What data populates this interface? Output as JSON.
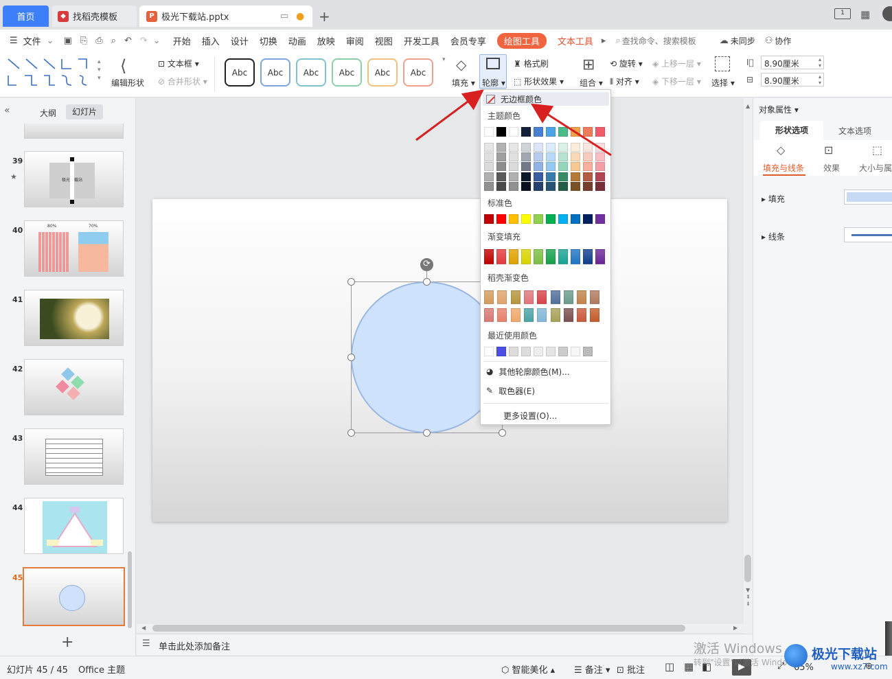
{
  "tabs": {
    "home": "首页",
    "template": "找稻壳模板",
    "document": "极光下载站.pptx"
  },
  "menu": {
    "file": "文件",
    "items": [
      "开始",
      "插入",
      "设计",
      "切换",
      "动画",
      "放映",
      "审阅",
      "视图",
      "开发工具",
      "会员专享"
    ],
    "drawing_tools": "绘图工具",
    "text_tools": "文本工具",
    "search_placeholder": "查找命令、搜索模板",
    "sync": "未同步",
    "collab": "协作"
  },
  "ribbon": {
    "textbox": "文本框",
    "edit_shape": "编辑形状",
    "merge_shape": "合并形状",
    "style_label": "Abc",
    "fill": "填充",
    "outline": "轮廓",
    "format_painter": "格式刷",
    "shape_effects": "形状效果",
    "group": "组合",
    "rotate": "旋转",
    "align": "对齐",
    "bring_forward": "上移一层",
    "send_backward": "下移一层",
    "select": "选择",
    "height": "8.90厘米",
    "width": "8.90厘米"
  },
  "left_panel": {
    "outline_tab": "大纲",
    "slides_tab": "幻灯片",
    "slide_numbers": [
      "39",
      "40",
      "41",
      "42",
      "43",
      "44",
      "45"
    ],
    "thumb39_text": "极光下载站",
    "thumb40_labels": [
      "80%",
      "70%"
    ]
  },
  "notes": {
    "placeholder": "单击此处添加备注"
  },
  "status": {
    "slide_info": "幻灯片 45 / 45",
    "theme": "Office 主题",
    "smart_beautify": "智能美化",
    "notes": "备注",
    "comments": "批注",
    "zoom": "65%"
  },
  "right_panel": {
    "title": "对象属性",
    "tab_shape": "形状选项",
    "tab_text": "文本选项",
    "sub_fill_line": "填充与线条",
    "sub_effects": "效果",
    "sub_size": "大小与属",
    "fill": "填充",
    "line": "线条"
  },
  "dropdown": {
    "no_border": "无边框颜色",
    "theme_colors": "主题颜色",
    "standard_colors": "标准色",
    "gradient_fill": "渐变填充",
    "docer_gradient": "稻壳渐变色",
    "recent_colors": "最近使用颜色",
    "more_colors": "其他轮廓颜色(M)...",
    "eyedropper": "取色器(E)",
    "more_settings": "更多设置(O)...",
    "theme_row": [
      "#ffffff",
      "#000000",
      "#ffffff",
      "#14213b",
      "#4a7fd6",
      "#4ca5e8",
      "#4cba8a",
      "#f0a34a",
      "#f07c5c",
      "#ef5b6b"
    ],
    "standard_row": [
      "#c00000",
      "#ff0000",
      "#ffc000",
      "#ffff00",
      "#92d050",
      "#00b050",
      "#00b0f0",
      "#0070c0",
      "#002060",
      "#7030a0"
    ],
    "gradient_row": [
      "#c00000",
      "#e2393c",
      "#e0a100",
      "#d8d400",
      "#7cbd42",
      "#14a049",
      "#18a394",
      "#1f74c2",
      "#123e8c",
      "#6a2596"
    ],
    "docer_row1": [
      "#d49c5d",
      "#e0a36c",
      "#b6953c",
      "#e0757a",
      "#d7444b",
      "#51709c",
      "#6b9b8d",
      "#c2844b",
      "#b07a5e"
    ],
    "docer_row2": [
      "#d87a75",
      "#e6826a",
      "#efa86a",
      "#4aa3a6",
      "#83b7d9",
      "#a7a15a",
      "#7d5050",
      "#c95a3c",
      "#c25c2c"
    ],
    "recent_row": [
      "#ffffff",
      "#4b4fe6",
      "#dddddd",
      "#dddddd",
      "#eeeeee",
      "#e5e5e5",
      "#cccccc",
      "#f7f7f7",
      "#bbbbbb"
    ]
  },
  "watermark": {
    "line1": "激活 Windows",
    "line2": "转到\"设置\"以激活 Windows。",
    "brand": "极光下载站",
    "url": "www.xz7.com"
  }
}
